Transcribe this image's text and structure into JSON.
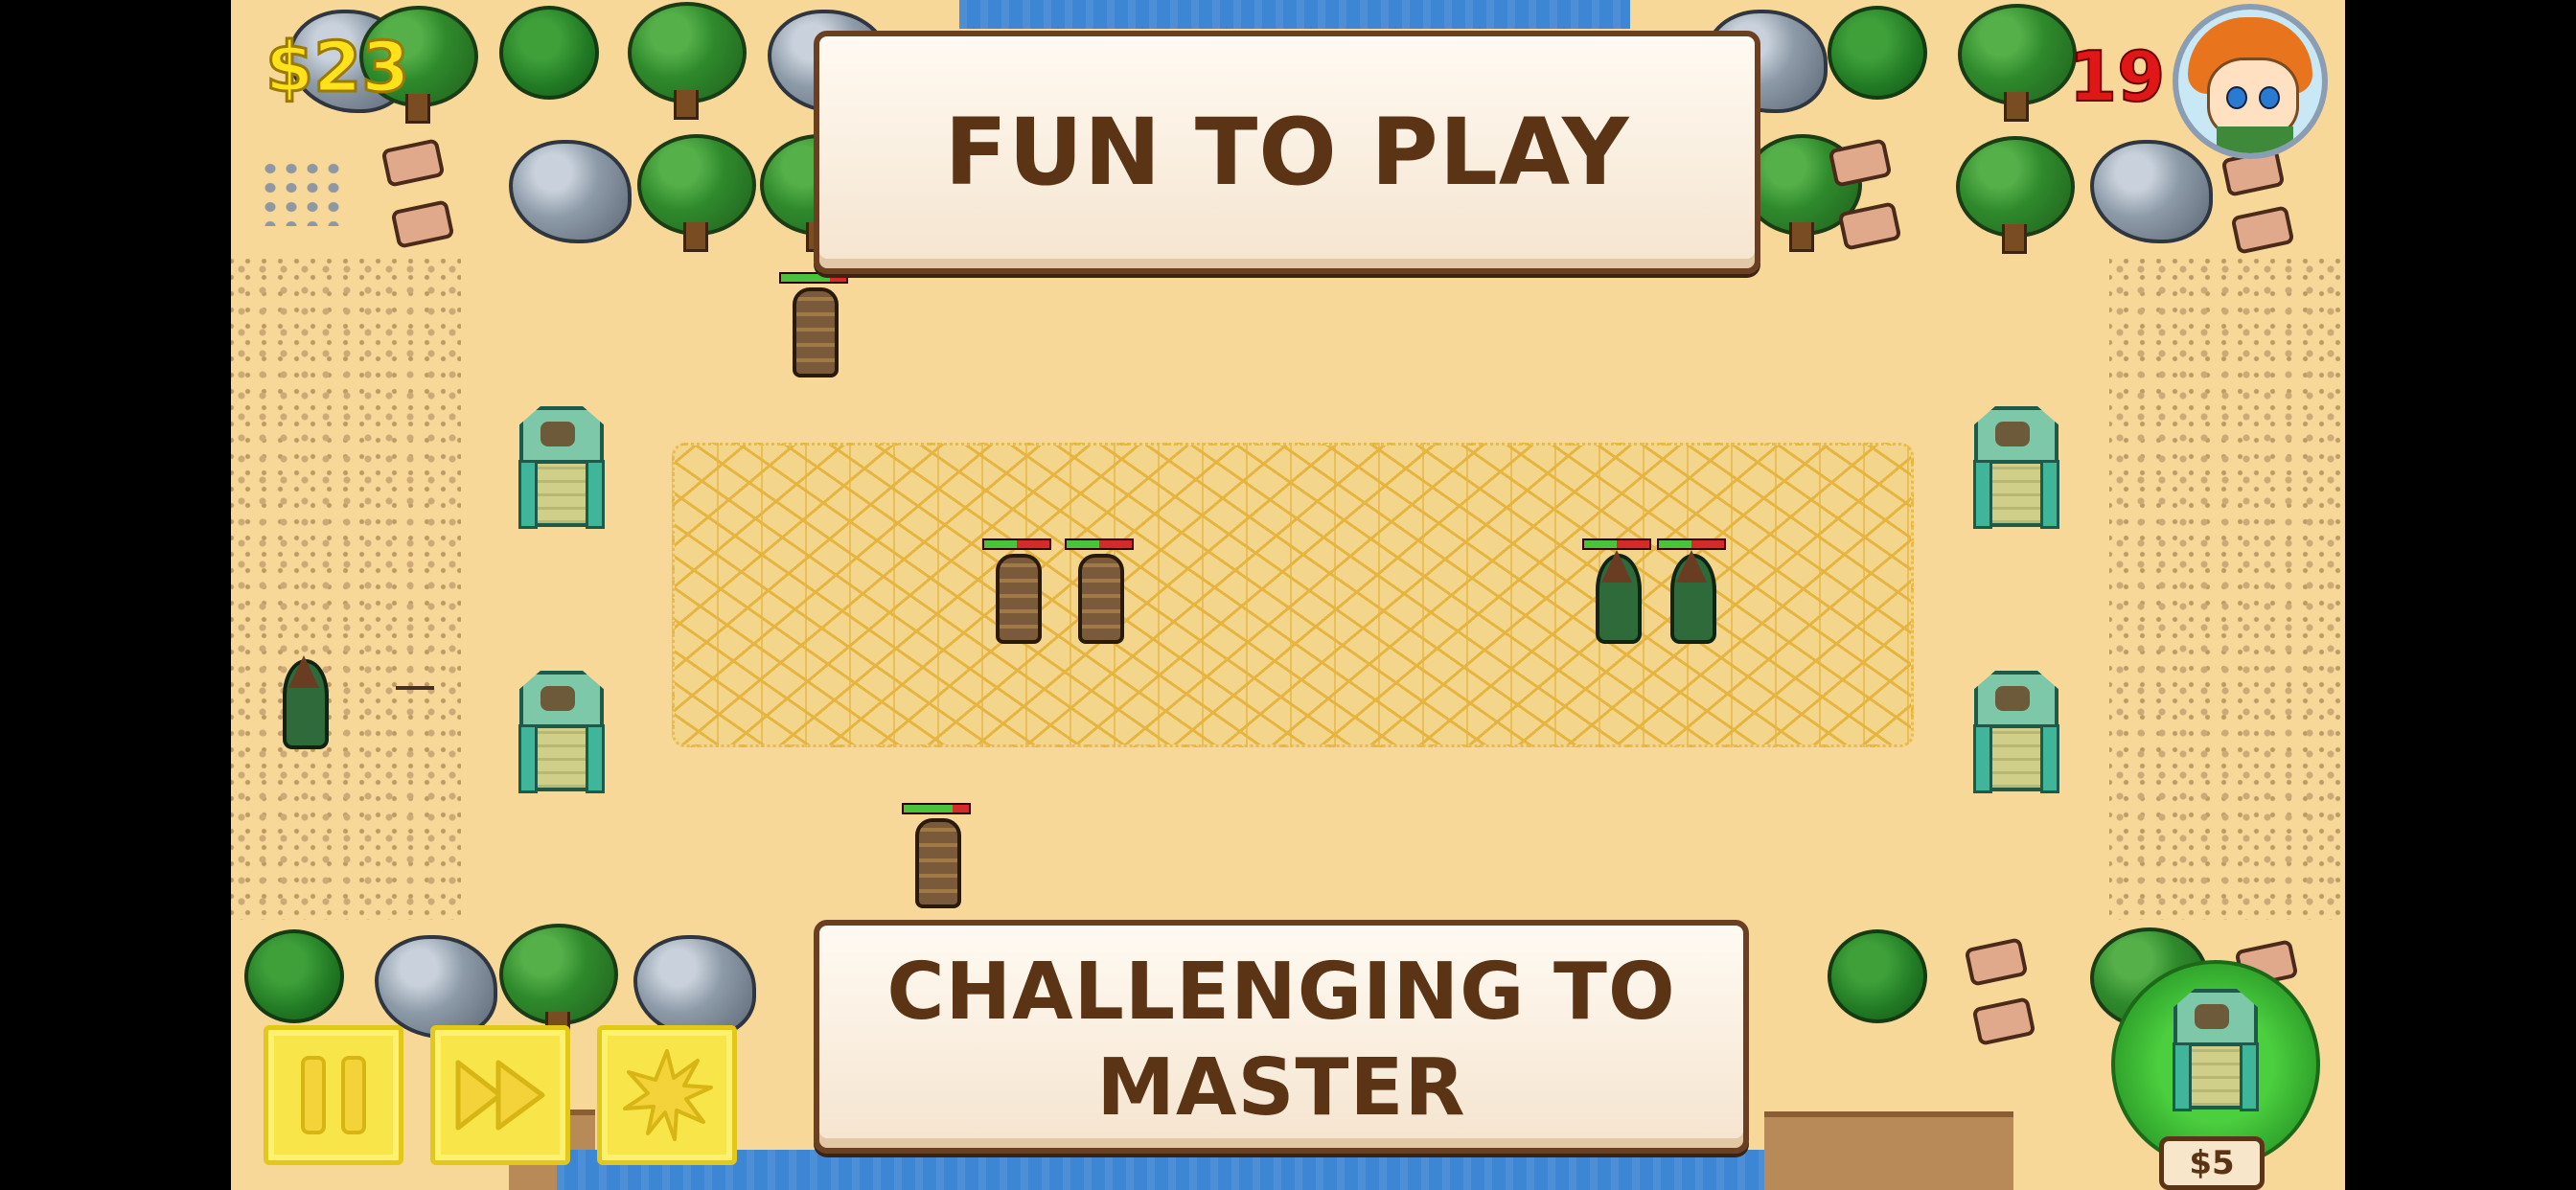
{
  "hud": {
    "money": "$23",
    "lives": "19",
    "avatar": "hero-portrait"
  },
  "banners": {
    "top": "FUN TO PLAY",
    "bottom_line1": "CHALLENGING TO",
    "bottom_line2": "MASTER"
  },
  "controls": {
    "pause_icon": "pause-icon",
    "fast_forward_icon": "fast-forward-icon",
    "special_icon": "sun-burst-icon"
  },
  "shop": {
    "tower_price": "$5"
  },
  "units": {
    "spiky_hp": [
      0.75,
      0.5,
      0.5,
      0.75
    ],
    "hooded_hp": [
      0.5,
      0.5
    ]
  },
  "colors": {
    "sand": "#f7d898",
    "water": "#3d86d4",
    "money": "#ffe21a",
    "lives": "#e01717",
    "banner_text": "#5b3416",
    "control_button": "#f7e54a"
  }
}
